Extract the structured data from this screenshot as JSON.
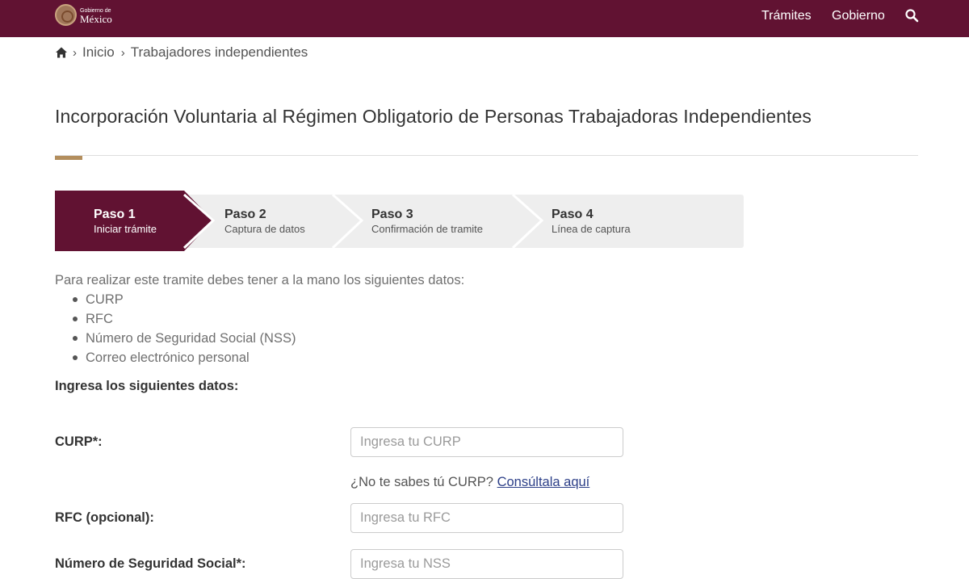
{
  "header": {
    "logo_small": "Gobierno de",
    "logo_big": "México",
    "nav": [
      "Trámites",
      "Gobierno"
    ],
    "search_icon": "search-icon"
  },
  "breadcrumb": {
    "home_icon": "home-icon",
    "items": [
      "Inicio",
      "Trabajadores independientes"
    ]
  },
  "title": "Incorporación Voluntaria al Régimen Obligatorio de Personas Trabajadoras Independientes",
  "stepper": {
    "steps": [
      {
        "title": "Paso 1",
        "subtitle": "Iniciar trámite",
        "active": true
      },
      {
        "title": "Paso 2",
        "subtitle": "Captura de datos",
        "active": false
      },
      {
        "title": "Paso 3",
        "subtitle": "Confirmación de tramite",
        "active": false
      },
      {
        "title": "Paso 4",
        "subtitle": "Línea de captura",
        "active": false
      }
    ]
  },
  "intro": "Para realizar este tramite debes tener a la mano los siguientes datos:",
  "requirements": [
    "CURP",
    "RFC",
    "Número de Seguridad Social (NSS)",
    "Correo electrónico personal"
  ],
  "form": {
    "heading": "Ingresa los siguientes datos:",
    "curp": {
      "label": "CURP*:",
      "placeholder": "Ingresa tu CURP",
      "value": ""
    },
    "curp_help": {
      "text": "¿No te sabes tú CURP?",
      "link": "Consúltala aquí"
    },
    "rfc": {
      "label": "RFC (opcional):",
      "placeholder": "Ingresa tu RFC",
      "value": ""
    },
    "nss": {
      "label": "Número de Seguridad Social*:",
      "placeholder": "Ingresa tu NSS",
      "value": ""
    }
  },
  "colors": {
    "brand": "#611232",
    "accent": "#b38e5d",
    "link": "#2c3f88",
    "step_inactive": "#eeeeee"
  }
}
